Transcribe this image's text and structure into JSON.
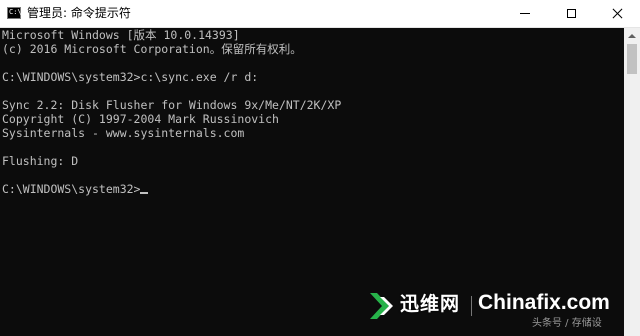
{
  "window": {
    "title": "管理员: 命令提示符",
    "icon_text": "C:\\"
  },
  "console": {
    "lines": [
      "Microsoft Windows [版本 10.0.14393]",
      "(c) 2016 Microsoft Corporation。保留所有权利。",
      "",
      "C:\\WINDOWS\\system32>c:\\sync.exe /r d:",
      "",
      "Sync 2.2: Disk Flusher for Windows 9x/Me/NT/2K/XP",
      "Copyright (C) 1997-2004 Mark Russinovich",
      "Sysinternals - www.sysinternals.com",
      "",
      "Flushing: D",
      ""
    ],
    "prompt": "C:\\WINDOWS\\system32>"
  },
  "watermark": {
    "brand": "迅维网",
    "site": "Chinafix.com",
    "sub": "头条号 / 存储设"
  },
  "colors": {
    "console_bg": "#0c0c0c",
    "console_text": "#c0c0c0",
    "logo_green": "#27b34a"
  },
  "icons": [
    "cmd-app-icon",
    "minimize-icon",
    "maximize-icon",
    "close-icon",
    "scroll-up-icon",
    "chinafix-logo-icon"
  ]
}
